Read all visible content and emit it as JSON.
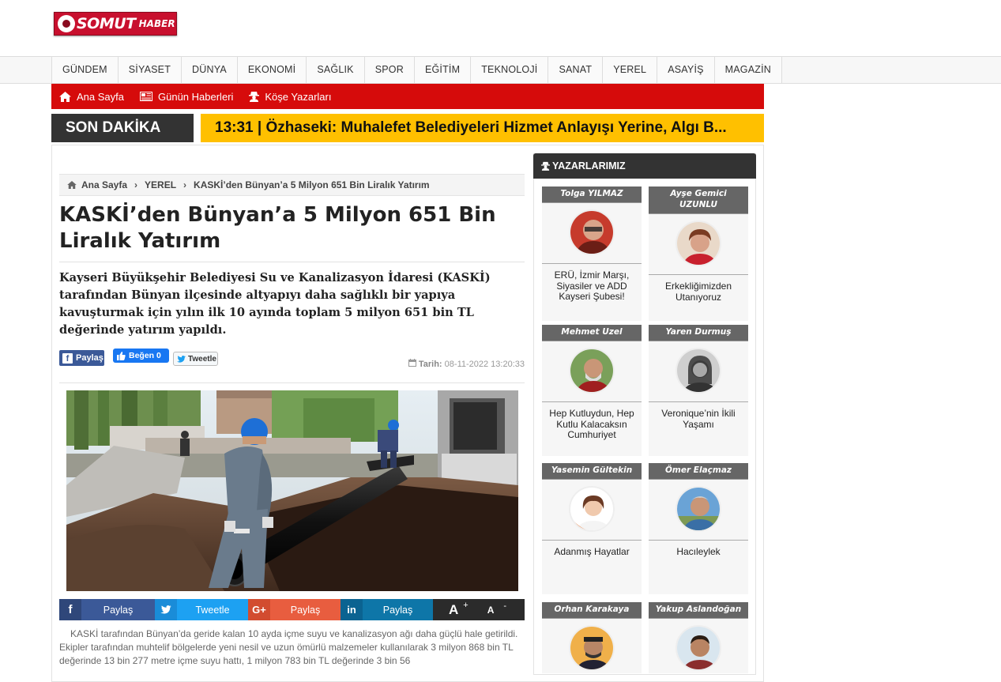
{
  "site": {
    "logo_main": "SOMUT",
    "logo_sub": "HABER"
  },
  "nav": {
    "items": [
      "GÜNDEM",
      "SİYASET",
      "DÜNYA",
      "EKONOMİ",
      "SAĞLIK",
      "SPOR",
      "EĞİTİM",
      "TEKNOLOJİ",
      "SANAT",
      "YEREL",
      "ASAYİŞ",
      "MAGAZİN"
    ]
  },
  "redbar": {
    "home": "Ana Sayfa",
    "daily": "Günün Haberleri",
    "columnists": "Köşe Yazarları"
  },
  "breaking": {
    "label": "SON DAKİKA",
    "text": "13:31 | Özhaseki: Muhalefet Belediyeleri Hizmet Anlayışı Yerine, Algı B..."
  },
  "breadcrumb": {
    "home": "Ana Sayfa",
    "section": "YEREL",
    "current": "KASKİ’den Bünyan’a 5 Milyon 651 Bin Liralık Yatırım"
  },
  "article": {
    "title": "KASKİ’den Bünyan’a 5 Milyon 651 Bin Liralık Yatırım",
    "summary": "Kayseri Büyükşehir Belediyesi Su ve Kanalizasyon İdaresi (KASKİ) tarafından Bünyan ilçesinde altyapıyı daha sağlıklı bir yapıya kavuşturmak için yılın ilk 10 ayında toplam 5 milyon 651 bin TL değerinde yatırım yapıldı.",
    "date_label": "Tarih:",
    "date_value": "08-11-2022 13:20:33",
    "body": "KASKİ tarafından Bünyan’da geride kalan 10 ayda içme suyu ve kanalizasyon ağı daha güçlü hale getirildi. Ekipler tarafından muhtelif bölgelerde yeni nesil ve uzun ömürlü malzemeler kullanılarak 3 milyon 868 bin TL değerinde 13 bin 277 metre içme suyu hattı, 1 milyon 783 bin TL değerinde 3 bin 56"
  },
  "social_top": {
    "fb_share": "Paylaş",
    "fb_like": "Beğen 0",
    "tweet": "Tweetle"
  },
  "share_bar": {
    "facebook": "Paylaş",
    "twitter": "Tweetle",
    "google": "Paylaş",
    "linkedin": "Paylaş",
    "font_up": "A",
    "font_down": "A",
    "plus": "+",
    "minus": "-"
  },
  "sidebar": {
    "title": "YAZARLARIMIZ",
    "authors": [
      {
        "name": "Tolga YILMAZ",
        "post": "ERÜ, İzmir Marşı, Siyasiler ve ADD Kayseri Şubesi!"
      },
      {
        "name": "Ayşe Gemici UZUNLU",
        "post": "Erkekliğimizden Utanıyoruz"
      },
      {
        "name": "Mehmet Uzel",
        "post": "Hep Kutluydun, Hep Kutlu Kalacaksın Cumhuriyet"
      },
      {
        "name": "Yaren Durmuş",
        "post": "Veronique’nin İkili Yaşamı"
      },
      {
        "name": "Yasemin Gültekin",
        "post": "Adanmış Hayatlar"
      },
      {
        "name": "Ömer Elaçmaz",
        "post": "Hacıleylek"
      },
      {
        "name": "Orhan Karakaya",
        "post": ""
      },
      {
        "name": "Yakup Aslandoğan",
        "post": ""
      }
    ]
  },
  "colors": {
    "brand_red": "#d60b0b",
    "ticker_yellow": "#ffc000",
    "dark": "#333333",
    "facebook": "#3b5998",
    "twitter": "#1da1f2",
    "google": "#dd4b39",
    "linkedin": "#0077b5"
  }
}
